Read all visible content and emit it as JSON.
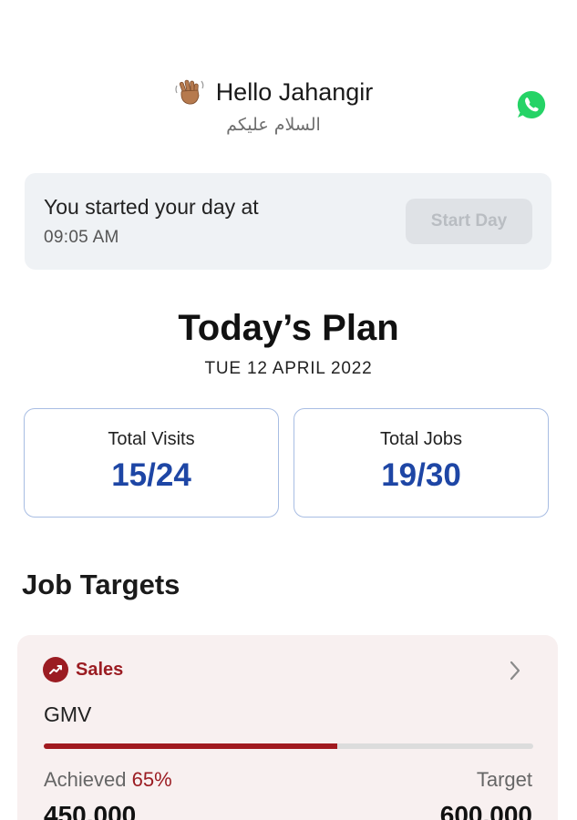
{
  "header": {
    "greeting": "Hello Jahangir",
    "greeting_sub": "السلام عليكم",
    "wave_icon": "waving-hand-icon",
    "whatsapp_icon": "whatsapp-icon"
  },
  "day": {
    "text": "You started your day at",
    "time": "09:05 AM",
    "button_label": "Start Day"
  },
  "plan": {
    "title": "Today’s Plan",
    "date": "TUE 12 APRIL 2022"
  },
  "stats": [
    {
      "label": "Total Visits",
      "value": "15/24"
    },
    {
      "label": "Total Jobs",
      "value": "19/30"
    }
  ],
  "job_targets": {
    "title": "Job Targets",
    "card": {
      "category": "Sales",
      "metric": "GMV",
      "progress": 0.6,
      "achieved_label": "Achieved",
      "achieved_pct": "65%",
      "target_label": "Target",
      "achieved_value": "450,000",
      "target_value": "600,000"
    }
  },
  "colors": {
    "accent_blue": "#1e46a5",
    "accent_red": "#9b1c22",
    "card_gray": "#eff2f5",
    "card_pink": "#f8f0f0"
  }
}
